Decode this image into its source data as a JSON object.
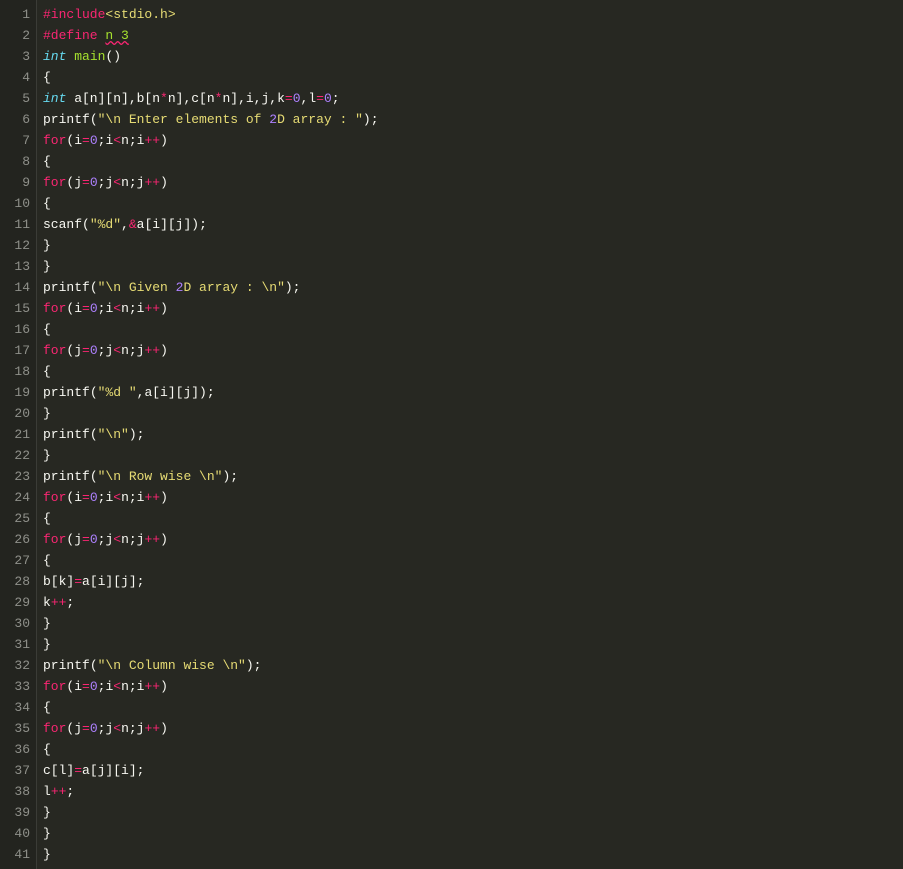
{
  "lines": [
    {
      "num": "1",
      "tokens": [
        {
          "t": "#include",
          "c": "tok-preproc"
        },
        {
          "t": "<stdio.h>",
          "c": "tok-include-path"
        }
      ]
    },
    {
      "num": "2",
      "tokens": [
        {
          "t": "#define ",
          "c": "tok-preproc"
        },
        {
          "t": "n 3",
          "c": "tok-define-name"
        }
      ]
    },
    {
      "num": "3",
      "tokens": [
        {
          "t": "int",
          "c": "tok-keyword"
        },
        {
          "t": " ",
          "c": "tok-plain"
        },
        {
          "t": "main",
          "c": "tok-func"
        },
        {
          "t": "()",
          "c": "tok-plain"
        }
      ]
    },
    {
      "num": "4",
      "tokens": [
        {
          "t": "{",
          "c": "tok-plain"
        }
      ]
    },
    {
      "num": "5",
      "tokens": [
        {
          "t": "int",
          "c": "tok-keyword"
        },
        {
          "t": " a[n][n],b[n",
          "c": "tok-plain"
        },
        {
          "t": "*",
          "c": "tok-op"
        },
        {
          "t": "n],c[n",
          "c": "tok-plain"
        },
        {
          "t": "*",
          "c": "tok-op"
        },
        {
          "t": "n],i,j,k",
          "c": "tok-plain"
        },
        {
          "t": "=",
          "c": "tok-op"
        },
        {
          "t": "0",
          "c": "tok-num"
        },
        {
          "t": ",l",
          "c": "tok-plain"
        },
        {
          "t": "=",
          "c": "tok-op"
        },
        {
          "t": "0",
          "c": "tok-num"
        },
        {
          "t": ";",
          "c": "tok-plain"
        }
      ]
    },
    {
      "num": "6",
      "tokens": [
        {
          "t": "printf",
          "c": "tok-plain"
        },
        {
          "t": "(",
          "c": "tok-plain"
        },
        {
          "t": "\"\\n Enter elements of ",
          "c": "tok-str"
        },
        {
          "t": "2",
          "c": "tok-num"
        },
        {
          "t": "D array : \"",
          "c": "tok-str"
        },
        {
          "t": ");",
          "c": "tok-plain"
        }
      ]
    },
    {
      "num": "7",
      "tokens": [
        {
          "t": "for",
          "c": "tok-ctrl"
        },
        {
          "t": "(i",
          "c": "tok-plain"
        },
        {
          "t": "=",
          "c": "tok-op"
        },
        {
          "t": "0",
          "c": "tok-num"
        },
        {
          "t": ";i",
          "c": "tok-plain"
        },
        {
          "t": "<",
          "c": "tok-op"
        },
        {
          "t": "n;i",
          "c": "tok-plain"
        },
        {
          "t": "++",
          "c": "tok-op"
        },
        {
          "t": ")",
          "c": "tok-plain"
        }
      ]
    },
    {
      "num": "8",
      "tokens": [
        {
          "t": "{",
          "c": "tok-plain"
        }
      ]
    },
    {
      "num": "9",
      "tokens": [
        {
          "t": "for",
          "c": "tok-ctrl"
        },
        {
          "t": "(j",
          "c": "tok-plain"
        },
        {
          "t": "=",
          "c": "tok-op"
        },
        {
          "t": "0",
          "c": "tok-num"
        },
        {
          "t": ";j",
          "c": "tok-plain"
        },
        {
          "t": "<",
          "c": "tok-op"
        },
        {
          "t": "n;j",
          "c": "tok-plain"
        },
        {
          "t": "++",
          "c": "tok-op"
        },
        {
          "t": ")",
          "c": "tok-plain"
        }
      ]
    },
    {
      "num": "10",
      "tokens": [
        {
          "t": "{",
          "c": "tok-plain"
        }
      ]
    },
    {
      "num": "11",
      "tokens": [
        {
          "t": "scanf",
          "c": "tok-plain"
        },
        {
          "t": "(",
          "c": "tok-plain"
        },
        {
          "t": "\"%d\"",
          "c": "tok-str"
        },
        {
          "t": ",",
          "c": "tok-plain"
        },
        {
          "t": "&",
          "c": "tok-op"
        },
        {
          "t": "a[i][j]);",
          "c": "tok-plain"
        }
      ]
    },
    {
      "num": "12",
      "tokens": [
        {
          "t": "}",
          "c": "tok-plain"
        }
      ]
    },
    {
      "num": "13",
      "tokens": [
        {
          "t": "}",
          "c": "tok-plain"
        }
      ]
    },
    {
      "num": "14",
      "tokens": [
        {
          "t": "printf",
          "c": "tok-plain"
        },
        {
          "t": "(",
          "c": "tok-plain"
        },
        {
          "t": "\"\\n Given ",
          "c": "tok-str"
        },
        {
          "t": "2",
          "c": "tok-num"
        },
        {
          "t": "D array : \\n\"",
          "c": "tok-str"
        },
        {
          "t": ");",
          "c": "tok-plain"
        }
      ]
    },
    {
      "num": "15",
      "tokens": [
        {
          "t": "for",
          "c": "tok-ctrl"
        },
        {
          "t": "(i",
          "c": "tok-plain"
        },
        {
          "t": "=",
          "c": "tok-op"
        },
        {
          "t": "0",
          "c": "tok-num"
        },
        {
          "t": ";i",
          "c": "tok-plain"
        },
        {
          "t": "<",
          "c": "tok-op"
        },
        {
          "t": "n;i",
          "c": "tok-plain"
        },
        {
          "t": "++",
          "c": "tok-op"
        },
        {
          "t": ")",
          "c": "tok-plain"
        }
      ]
    },
    {
      "num": "16",
      "tokens": [
        {
          "t": "{",
          "c": "tok-plain"
        }
      ]
    },
    {
      "num": "17",
      "tokens": [
        {
          "t": "for",
          "c": "tok-ctrl"
        },
        {
          "t": "(j",
          "c": "tok-plain"
        },
        {
          "t": "=",
          "c": "tok-op"
        },
        {
          "t": "0",
          "c": "tok-num"
        },
        {
          "t": ";j",
          "c": "tok-plain"
        },
        {
          "t": "<",
          "c": "tok-op"
        },
        {
          "t": "n;j",
          "c": "tok-plain"
        },
        {
          "t": "++",
          "c": "tok-op"
        },
        {
          "t": ")",
          "c": "tok-plain"
        }
      ]
    },
    {
      "num": "18",
      "tokens": [
        {
          "t": "{",
          "c": "tok-plain"
        }
      ]
    },
    {
      "num": "19",
      "tokens": [
        {
          "t": "printf",
          "c": "tok-plain"
        },
        {
          "t": "(",
          "c": "tok-plain"
        },
        {
          "t": "\"%d \"",
          "c": "tok-str"
        },
        {
          "t": ",a[i][j]);",
          "c": "tok-plain"
        }
      ]
    },
    {
      "num": "20",
      "tokens": [
        {
          "t": "}",
          "c": "tok-plain"
        }
      ]
    },
    {
      "num": "21",
      "tokens": [
        {
          "t": "printf",
          "c": "tok-plain"
        },
        {
          "t": "(",
          "c": "tok-plain"
        },
        {
          "t": "\"\\n\"",
          "c": "tok-str"
        },
        {
          "t": ");",
          "c": "tok-plain"
        }
      ]
    },
    {
      "num": "22",
      "tokens": [
        {
          "t": "}",
          "c": "tok-plain"
        }
      ]
    },
    {
      "num": "23",
      "tokens": [
        {
          "t": "printf",
          "c": "tok-plain"
        },
        {
          "t": "(",
          "c": "tok-plain"
        },
        {
          "t": "\"\\n Row wise \\n\"",
          "c": "tok-str"
        },
        {
          "t": ");",
          "c": "tok-plain"
        }
      ]
    },
    {
      "num": "24",
      "tokens": [
        {
          "t": "for",
          "c": "tok-ctrl"
        },
        {
          "t": "(i",
          "c": "tok-plain"
        },
        {
          "t": "=",
          "c": "tok-op"
        },
        {
          "t": "0",
          "c": "tok-num"
        },
        {
          "t": ";i",
          "c": "tok-plain"
        },
        {
          "t": "<",
          "c": "tok-op"
        },
        {
          "t": "n;i",
          "c": "tok-plain"
        },
        {
          "t": "++",
          "c": "tok-op"
        },
        {
          "t": ")",
          "c": "tok-plain"
        }
      ]
    },
    {
      "num": "25",
      "tokens": [
        {
          "t": "{",
          "c": "tok-plain"
        }
      ]
    },
    {
      "num": "26",
      "tokens": [
        {
          "t": "for",
          "c": "tok-ctrl"
        },
        {
          "t": "(j",
          "c": "tok-plain"
        },
        {
          "t": "=",
          "c": "tok-op"
        },
        {
          "t": "0",
          "c": "tok-num"
        },
        {
          "t": ";j",
          "c": "tok-plain"
        },
        {
          "t": "<",
          "c": "tok-op"
        },
        {
          "t": "n;j",
          "c": "tok-plain"
        },
        {
          "t": "++",
          "c": "tok-op"
        },
        {
          "t": ")",
          "c": "tok-plain"
        }
      ]
    },
    {
      "num": "27",
      "tokens": [
        {
          "t": "{",
          "c": "tok-plain"
        }
      ]
    },
    {
      "num": "28",
      "tokens": [
        {
          "t": "b[k]",
          "c": "tok-plain"
        },
        {
          "t": "=",
          "c": "tok-op"
        },
        {
          "t": "a[i][j];",
          "c": "tok-plain"
        }
      ]
    },
    {
      "num": "29",
      "tokens": [
        {
          "t": "k",
          "c": "tok-plain"
        },
        {
          "t": "++",
          "c": "tok-op"
        },
        {
          "t": ";",
          "c": "tok-plain"
        }
      ]
    },
    {
      "num": "30",
      "tokens": [
        {
          "t": "}",
          "c": "tok-plain"
        }
      ]
    },
    {
      "num": "31",
      "tokens": [
        {
          "t": "}",
          "c": "tok-plain"
        }
      ]
    },
    {
      "num": "32",
      "tokens": [
        {
          "t": "printf",
          "c": "tok-plain"
        },
        {
          "t": "(",
          "c": "tok-plain"
        },
        {
          "t": "\"\\n Column wise \\n\"",
          "c": "tok-str"
        },
        {
          "t": ");",
          "c": "tok-plain"
        }
      ]
    },
    {
      "num": "33",
      "tokens": [
        {
          "t": "for",
          "c": "tok-ctrl"
        },
        {
          "t": "(i",
          "c": "tok-plain"
        },
        {
          "t": "=",
          "c": "tok-op"
        },
        {
          "t": "0",
          "c": "tok-num"
        },
        {
          "t": ";i",
          "c": "tok-plain"
        },
        {
          "t": "<",
          "c": "tok-op"
        },
        {
          "t": "n;i",
          "c": "tok-plain"
        },
        {
          "t": "++",
          "c": "tok-op"
        },
        {
          "t": ")",
          "c": "tok-plain"
        }
      ]
    },
    {
      "num": "34",
      "tokens": [
        {
          "t": "{",
          "c": "tok-plain"
        }
      ]
    },
    {
      "num": "35",
      "tokens": [
        {
          "t": "for",
          "c": "tok-ctrl"
        },
        {
          "t": "(j",
          "c": "tok-plain"
        },
        {
          "t": "=",
          "c": "tok-op"
        },
        {
          "t": "0",
          "c": "tok-num"
        },
        {
          "t": ";j",
          "c": "tok-plain"
        },
        {
          "t": "<",
          "c": "tok-op"
        },
        {
          "t": "n;j",
          "c": "tok-plain"
        },
        {
          "t": "++",
          "c": "tok-op"
        },
        {
          "t": ")",
          "c": "tok-plain"
        }
      ]
    },
    {
      "num": "36",
      "tokens": [
        {
          "t": "{",
          "c": "tok-plain"
        }
      ]
    },
    {
      "num": "37",
      "tokens": [
        {
          "t": "c[l]",
          "c": "tok-plain"
        },
        {
          "t": "=",
          "c": "tok-op"
        },
        {
          "t": "a[j][i];",
          "c": "tok-plain"
        }
      ]
    },
    {
      "num": "38",
      "tokens": [
        {
          "t": "l",
          "c": "tok-plain"
        },
        {
          "t": "++",
          "c": "tok-op"
        },
        {
          "t": ";",
          "c": "tok-plain"
        }
      ]
    },
    {
      "num": "39",
      "tokens": [
        {
          "t": "}",
          "c": "tok-plain"
        }
      ]
    },
    {
      "num": "40",
      "tokens": [
        {
          "t": "}",
          "c": "tok-plain"
        }
      ]
    },
    {
      "num": "41",
      "tokens": [
        {
          "t": "}",
          "c": "tok-plain"
        }
      ]
    }
  ]
}
